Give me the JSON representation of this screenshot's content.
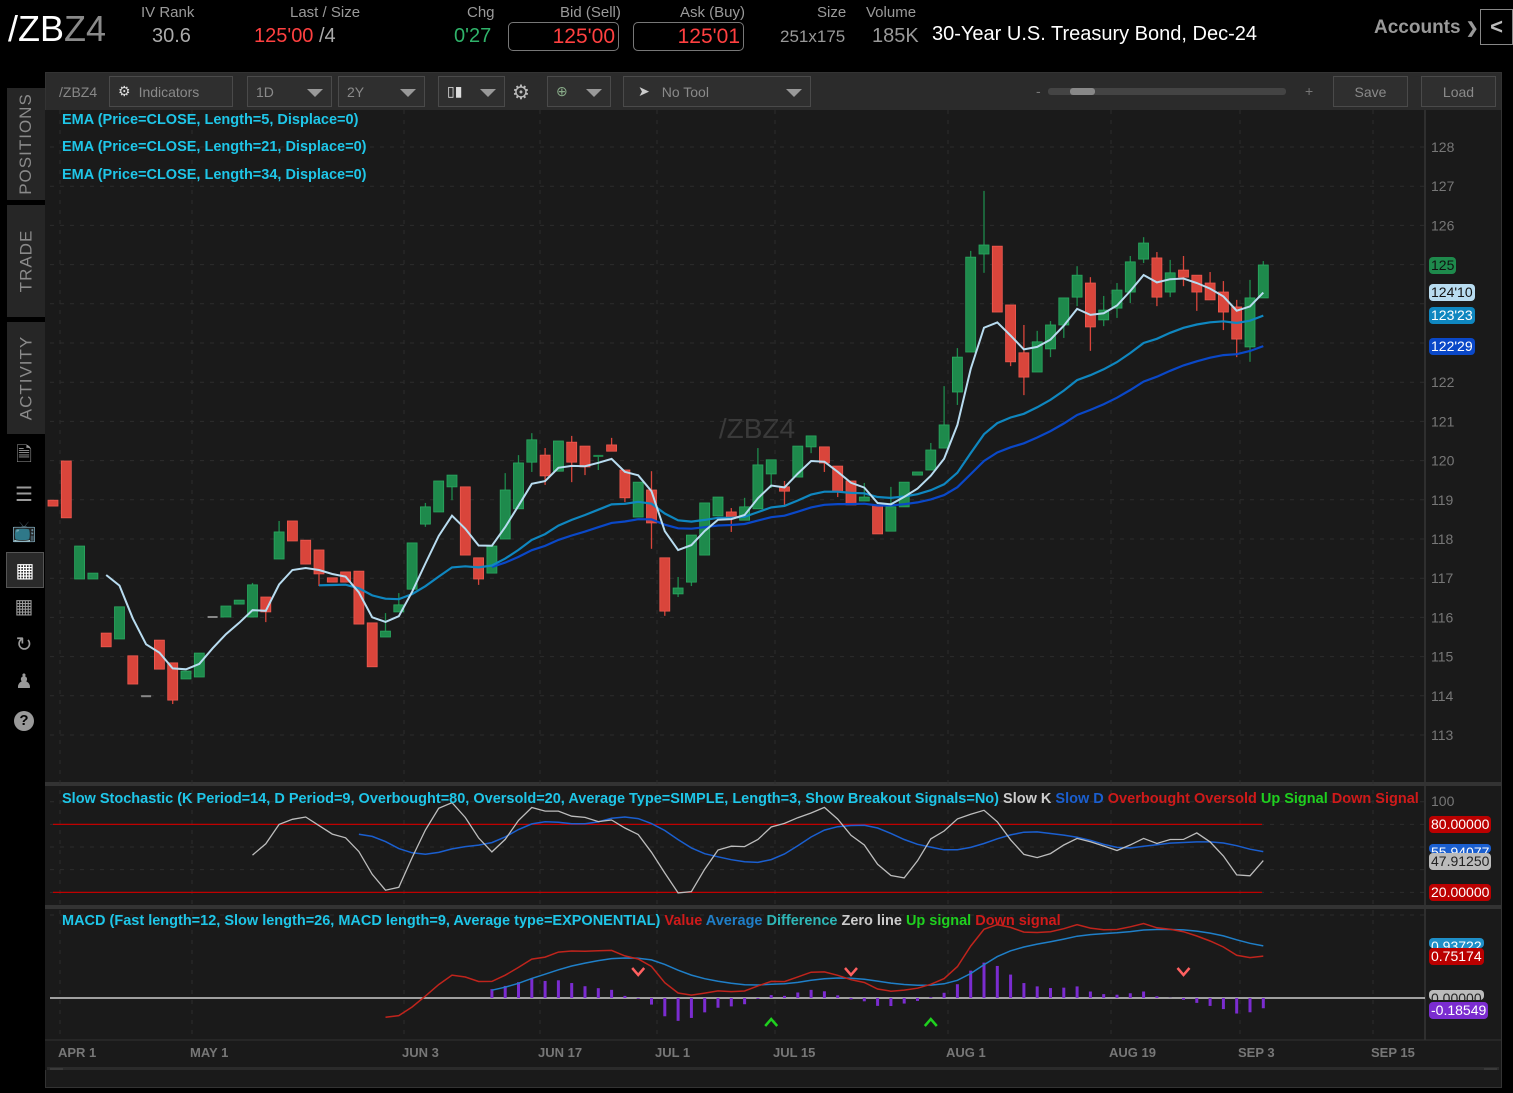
{
  "header": {
    "symbol_main": "/ZB",
    "symbol_suffix": "Z4",
    "iv_rank_label": "IV Rank",
    "iv_rank": "30.6",
    "last_size_label": "Last / Size",
    "last": "125'00",
    "size": "/4",
    "chg_label": "Chg",
    "chg": "0'27",
    "bid_label": "Bid (Sell)",
    "bid": "125'00",
    "ask_label": "Ask (Buy)",
    "ask": "125'01",
    "size_label": "Size",
    "size_val": "251x175",
    "volume_label": "Volume",
    "volume": "185K",
    "description": "30-Year U.S. Treasury Bond, Dec-24",
    "accounts": "Accounts",
    "collapse": "<"
  },
  "sidebar": {
    "tabs": [
      "POSITIONS",
      "TRADE",
      "ACTIVITY"
    ],
    "icons": [
      "news-icon",
      "list-icon",
      "tv-icon",
      "chart-icon",
      "grid-icon",
      "history-icon",
      "community-icon",
      "help-icon"
    ]
  },
  "toolbar": {
    "symbol": "/ZBZ4",
    "indicators": "Indicators",
    "aggregation": "1D",
    "timeframe": "2Y",
    "drawing_tool": "No Tool",
    "zoom_minus": "-",
    "zoom_plus": "+",
    "zoom_level": 0.05,
    "save": "Save",
    "load": "Load"
  },
  "price_panel": {
    "watermark": "/ZBZ4",
    "studies": [
      "EMA (Price=CLOSE, Length=5, Displace=0)",
      "EMA (Price=CLOSE, Length=21, Displace=0)",
      "EMA (Price=CLOSE, Length=34, Displace=0)"
    ],
    "axis_ticks": [
      "128",
      "127",
      "126",
      "122",
      "121",
      "120",
      "119",
      "118",
      "117",
      "116",
      "115",
      "114",
      "113"
    ],
    "badges": {
      "last": "125",
      "ema5": "124'10",
      "ema21": "123'23",
      "ema34": "122'29"
    }
  },
  "stoch_panel": {
    "title": "Slow Stochastic (K Period=14, D Period=9, Overbought=80, Oversold=20, Average Type=SIMPLE, Length=3, Show Breakout Signals=No)",
    "legend": {
      "k": "Slow K",
      "d": "Slow D",
      "ob": "Overbought",
      "os": "Oversold",
      "up": "Up Signal",
      "down": "Down Signal"
    },
    "axis_top": "100",
    "badges": {
      "ob": "80.00000",
      "d": "55.94077",
      "k": "47.91250",
      "os": "20.00000"
    }
  },
  "macd_panel": {
    "title": "MACD (Fast length=12, Slow length=26, MACD length=9, Average type=EXPONENTIAL)",
    "legend": {
      "value": "Value",
      "avg": "Average",
      "diff": "Difference",
      "zero": "Zero line",
      "up": "Up signal",
      "down": "Down signal"
    },
    "badges": {
      "avg": "0.93722",
      "value": "0.75174",
      "zero": "0.00000",
      "diff": "-0.18549"
    }
  },
  "x_axis": [
    "APR 1",
    "MAY 1",
    "JUN 3",
    "JUN 17",
    "JUL 1",
    "JUL 15",
    "AUG 1",
    "AUG 19",
    "SEP 3",
    "SEP 15"
  ],
  "colors": {
    "up": "#1e8a4c",
    "down": "#d9453b",
    "ema5": "#b8dcf0",
    "ema21": "#0f87c0",
    "ema34": "#0a48c8",
    "accent": "#1fc6e8"
  },
  "chart_data": {
    "type": "candlestick",
    "ohlc": [
      [
        118.99,
        118.99,
        118.84,
        118.84
      ],
      [
        119.99,
        119.99,
        118.54,
        118.54
      ],
      [
        116.98,
        117.82,
        116.98,
        117.82
      ],
      [
        116.98,
        117.13,
        116.98,
        117.13
      ],
      [
        115.6,
        115.6,
        115.25,
        115.25
      ],
      [
        115.45,
        116.27,
        115.45,
        116.27
      ],
      [
        115.02,
        115.02,
        114.3,
        114.3
      ],
      [
        113.99,
        113.99,
        113.99,
        113.99
      ],
      [
        115.42,
        115.42,
        114.68,
        114.68
      ],
      [
        114.84,
        114.84,
        113.79,
        113.89
      ],
      [
        114.43,
        114.63,
        114.43,
        114.63
      ],
      [
        114.48,
        115.09,
        114.48,
        115.09
      ],
      [
        116.01,
        116.01,
        116.01,
        116.01
      ],
      [
        116.01,
        116.29,
        116.01,
        116.29
      ],
      [
        116.34,
        116.44,
        116.34,
        116.44
      ],
      [
        116.01,
        116.88,
        116.01,
        116.83
      ],
      [
        116.52,
        116.52,
        115.88,
        116.14
      ],
      [
        117.49,
        118.46,
        117.49,
        118.18
      ],
      [
        118.46,
        118.46,
        117.95,
        117.95
      ],
      [
        117.97,
        117.97,
        117.36,
        117.36
      ],
      [
        117.72,
        117.72,
        116.8,
        117.11
      ],
      [
        117.01,
        117.01,
        116.9,
        116.9
      ],
      [
        117.16,
        117.16,
        116.9,
        116.9
      ],
      [
        117.18,
        117.18,
        115.83,
        115.83
      ],
      [
        115.86,
        115.86,
        114.74,
        114.74
      ],
      [
        115.5,
        116.11,
        115.5,
        115.65
      ],
      [
        116.14,
        116.62,
        116.14,
        116.32
      ],
      [
        116.72,
        117.9,
        116.72,
        117.9
      ],
      [
        118.38,
        118.92,
        118.31,
        118.82
      ],
      [
        118.69,
        119.48,
        118.69,
        119.48
      ],
      [
        119.33,
        119.63,
        118.99,
        119.63
      ],
      [
        119.33,
        119.33,
        117.59,
        117.59
      ],
      [
        117.52,
        117.52,
        116.83,
        116.98
      ],
      [
        117.13,
        117.82,
        117.13,
        117.82
      ],
      [
        118.0,
        119.68,
        118.0,
        119.25
      ],
      [
        118.77,
        120.14,
        118.77,
        119.94
      ],
      [
        119.96,
        120.7,
        119.71,
        120.53
      ],
      [
        120.14,
        120.32,
        119.38,
        119.61
      ],
      [
        119.73,
        120.5,
        119.73,
        120.5
      ],
      [
        120.47,
        120.63,
        119.45,
        119.96
      ],
      [
        120.37,
        120.37,
        119.63,
        119.84
      ],
      [
        120.09,
        120.14,
        119.76,
        120.12
      ],
      [
        120.4,
        120.58,
        120.24,
        120.24
      ],
      [
        119.76,
        119.76,
        118.94,
        119.05
      ],
      [
        118.56,
        119.45,
        118.56,
        119.45
      ],
      [
        119.25,
        119.73,
        117.75,
        118.41
      ],
      [
        117.52,
        117.52,
        116.04,
        116.16
      ],
      [
        116.6,
        117.03,
        116.52,
        116.75
      ],
      [
        116.9,
        118.1,
        116.8,
        118.1
      ],
      [
        117.59,
        118.92,
        117.59,
        118.92
      ],
      [
        118.59,
        119.07,
        118.59,
        119.07
      ],
      [
        118.69,
        118.79,
        118.18,
        118.54
      ],
      [
        118.48,
        119.05,
        118.48,
        118.82
      ],
      [
        118.77,
        120.32,
        118.77,
        119.89
      ],
      [
        119.66,
        120.02,
        119.3,
        120.02
      ],
      [
        119.33,
        119.48,
        118.87,
        119.22
      ],
      [
        119.58,
        120.37,
        119.58,
        120.37
      ],
      [
        120.35,
        120.63,
        120.19,
        120.63
      ],
      [
        120.35,
        120.35,
        119.71,
        119.94
      ],
      [
        119.86,
        119.86,
        119.07,
        119.2
      ],
      [
        119.48,
        119.48,
        118.87,
        118.87
      ],
      [
        118.97,
        119.43,
        118.97,
        119.07
      ],
      [
        118.87,
        118.87,
        118.13,
        118.13
      ],
      [
        118.2,
        119.33,
        118.2,
        118.82
      ],
      [
        118.82,
        119.45,
        118.82,
        119.45
      ],
      [
        119.63,
        119.71,
        119.63,
        119.71
      ],
      [
        119.76,
        120.45,
        119.76,
        120.27
      ],
      [
        120.32,
        121.9,
        120.32,
        120.91
      ],
      [
        121.75,
        122.87,
        121.42,
        122.64
      ],
      [
        122.77,
        125.35,
        122.77,
        125.19
      ],
      [
        125.27,
        126.88,
        124.79,
        125.5
      ],
      [
        125.47,
        125.47,
        123.79,
        123.79
      ],
      [
        123.97,
        123.97,
        122.41,
        122.52
      ],
      [
        122.75,
        123.46,
        121.67,
        122.13
      ],
      [
        122.26,
        123.31,
        122.26,
        123.03
      ],
      [
        122.85,
        123.56,
        122.64,
        123.46
      ],
      [
        123.46,
        124.15,
        123.13,
        124.15
      ],
      [
        124.17,
        124.96,
        123.94,
        124.73
      ],
      [
        124.53,
        124.68,
        122.8,
        123.41
      ],
      [
        123.59,
        124.2,
        123.43,
        123.84
      ],
      [
        123.89,
        124.53,
        123.64,
        124.35
      ],
      [
        124.3,
        125.22,
        124.02,
        125.07
      ],
      [
        125.14,
        125.7,
        125.04,
        125.55
      ],
      [
        125.17,
        125.32,
        123.94,
        124.17
      ],
      [
        124.3,
        125.12,
        124.17,
        124.79
      ],
      [
        124.86,
        125.22,
        124.45,
        124.68
      ],
      [
        124.73,
        124.73,
        123.82,
        124.3
      ],
      [
        124.53,
        124.81,
        124.1,
        124.1
      ],
      [
        124.3,
        124.58,
        123.33,
        123.79
      ],
      [
        123.92,
        124.1,
        122.64,
        123.1
      ],
      [
        122.9,
        124.61,
        122.52,
        124.15
      ],
      [
        124.15,
        125.09,
        124.15,
        124.99
      ]
    ],
    "ylim": [
      112.5,
      129
    ],
    "stoch_levels": [
      80,
      20
    ],
    "ema_lengths": [
      5,
      21,
      34
    ],
    "stoch_params": {
      "k": 14,
      "d": 9,
      "slow": 3
    },
    "macd_params": {
      "fast": 12,
      "slow": 26,
      "signal": 9
    }
  }
}
